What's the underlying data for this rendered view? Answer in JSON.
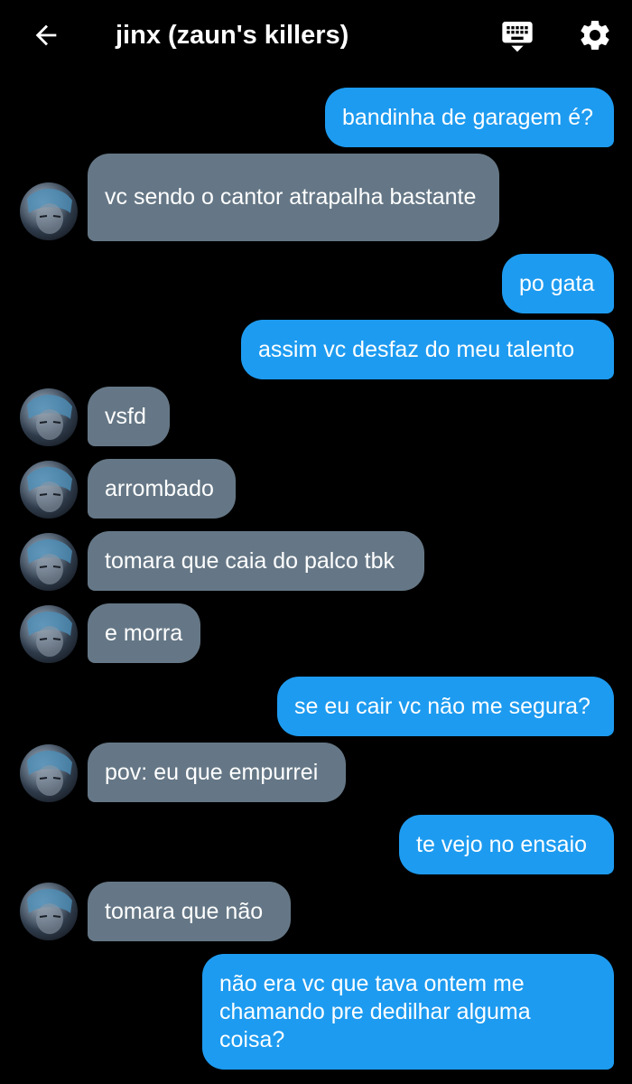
{
  "header": {
    "title": "jinx (zaun's killers)",
    "back_icon": "arrow-left-icon",
    "keyboard_icon": "keyboard-icon",
    "settings_icon": "gear-icon"
  },
  "colors": {
    "background": "#000000",
    "outgoing_bubble": "#1d9bf0",
    "incoming_bubble": "#657786",
    "text": "#ffffff"
  },
  "messages": [
    {
      "sender": "me",
      "text": "bandinha de garagem é?"
    },
    {
      "sender": "them",
      "text": "vc sendo o cantor atrapalha bastante"
    },
    {
      "sender": "me",
      "text": "po gata"
    },
    {
      "sender": "me",
      "text": "assim vc desfaz do meu talento"
    },
    {
      "sender": "them",
      "text": "vsfd"
    },
    {
      "sender": "them",
      "text": "arrombado"
    },
    {
      "sender": "them",
      "text": "tomara que caia do palco tbk"
    },
    {
      "sender": "them",
      "text": "e morra"
    },
    {
      "sender": "me",
      "text": "se eu cair vc não me segura?"
    },
    {
      "sender": "them",
      "text": "pov: eu que empurrei"
    },
    {
      "sender": "me",
      "text": "te vejo no ensaio"
    },
    {
      "sender": "them",
      "text": "tomara que não"
    },
    {
      "sender": "me",
      "text": "não era vc que tava ontem me chamando pre dedilhar alguma coisa?"
    }
  ]
}
